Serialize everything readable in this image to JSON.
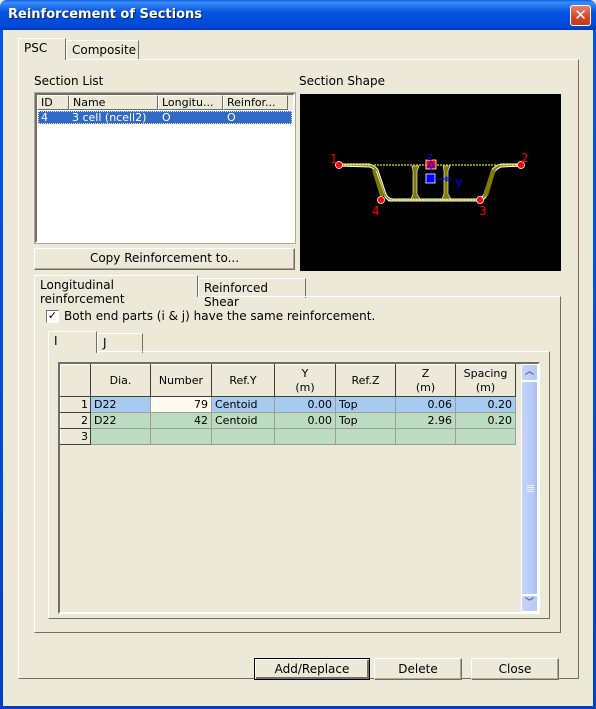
{
  "window": {
    "title": "Reinforcement of Sections",
    "close_icon": "close-x-icon"
  },
  "top_tabs": [
    {
      "label": "PSC",
      "active": true
    },
    {
      "label": "Composite",
      "active": false
    }
  ],
  "section_list": {
    "label": "Section List",
    "columns": [
      "ID",
      "Name",
      "Longitu...",
      "Reinfor..."
    ],
    "rows": [
      {
        "id": "4",
        "name": "3 cell (ncell2)",
        "longitudinal": "O",
        "reinforced": "O",
        "selected": true
      }
    ],
    "copy_button": "Copy Reinforcement to..."
  },
  "section_shape": {
    "label": "Section Shape",
    "background": "#000000",
    "section_fill": "#807c00",
    "outline_color": "#ffffff",
    "point_color": "#ff0000",
    "axis_color": "#0000ff",
    "point_labels": [
      "1",
      "2",
      "3",
      "4"
    ],
    "axis_labels": {
      "z": "z",
      "y": "y"
    }
  },
  "sub_tabs": [
    {
      "label": "Longitudinal reinforcement",
      "active": true
    },
    {
      "label": "Reinforced Shear",
      "active": false
    }
  ],
  "same_reinforcement": {
    "label": "Both end parts (i & j) have the same reinforcement.",
    "checked": true
  },
  "end_tabs": [
    {
      "label": "I",
      "active": true
    },
    {
      "label": "J",
      "active": false
    }
  ],
  "grid": {
    "headers": [
      "Dia.",
      "Number",
      "Ref.Y",
      "Y\n(m)",
      "Ref.Z",
      "Z\n(m)",
      "Spacing\n(m)"
    ],
    "header_lines": [
      [
        "Dia."
      ],
      [
        "Number"
      ],
      [
        "Ref.Y"
      ],
      [
        "Y",
        "(m)"
      ],
      [
        "Ref.Z"
      ],
      [
        "Z",
        "(m)"
      ],
      [
        "Spacing",
        "(m)"
      ]
    ],
    "rows": [
      {
        "n": "1",
        "dia": "D22",
        "number": "79",
        "ref_y": "Centoid",
        "y": "0.00",
        "ref_z": "Top",
        "z": "0.06",
        "spacing": "0.20",
        "selected": true
      },
      {
        "n": "2",
        "dia": "D22",
        "number": "42",
        "ref_y": "Centoid",
        "y": "0.00",
        "ref_z": "Top",
        "z": "2.96",
        "spacing": "0.20",
        "selected": false
      },
      {
        "n": "3",
        "dia": "",
        "number": "",
        "ref_y": "",
        "y": "",
        "ref_z": "",
        "z": "",
        "spacing": "",
        "selected": false
      }
    ],
    "selected_color": "#a6caf0",
    "row_color": "#bcdcc2"
  },
  "buttons": {
    "add_replace": "Add/Replace",
    "delete": "Delete",
    "close": "Close"
  }
}
